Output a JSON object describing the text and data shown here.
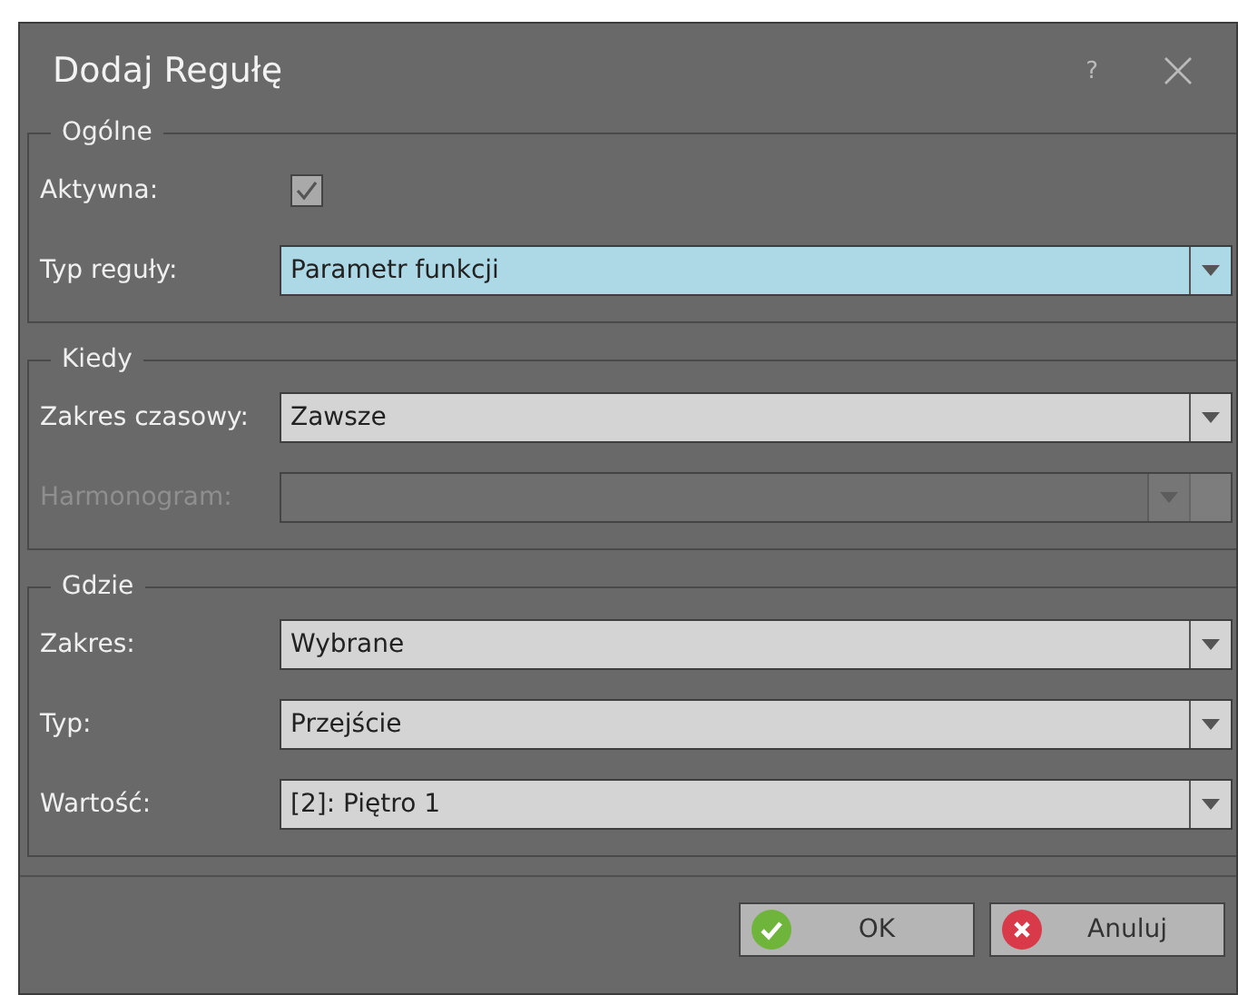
{
  "window": {
    "title": "Dodaj Regułę",
    "help": "?"
  },
  "groups": [
    {
      "title": "Ogólne",
      "rows": [
        {
          "kind": "checkbox",
          "label": "Aktywna:",
          "checked": true
        },
        {
          "kind": "combo",
          "label": "Typ reguły:",
          "value": "Parametr funkcji",
          "selected": true,
          "disabled": false
        }
      ]
    },
    {
      "title": "Kiedy",
      "rows": [
        {
          "kind": "combo",
          "label": "Zakres czasowy:",
          "value": "Zawsze",
          "selected": false,
          "disabled": false
        },
        {
          "kind": "combo",
          "label": "Harmonogram:",
          "selected": false,
          "disabled": true
        }
      ]
    },
    {
      "title": "Gdzie",
      "rows": [
        {
          "kind": "combo",
          "label": "Zakres:",
          "value": "Wybrane",
          "selected": false,
          "disabled": false
        },
        {
          "kind": "combo",
          "label": "Typ:",
          "value": "Przejście",
          "selected": false,
          "disabled": false
        },
        {
          "kind": "combo",
          "label": "Wartość:",
          "value": "[2]: Piętro 1",
          "selected": false,
          "disabled": false
        }
      ]
    }
  ],
  "buttons": [
    {
      "kind": "ok",
      "label": "OK"
    },
    {
      "kind": "cancel",
      "label": "Anuluj"
    }
  ]
}
